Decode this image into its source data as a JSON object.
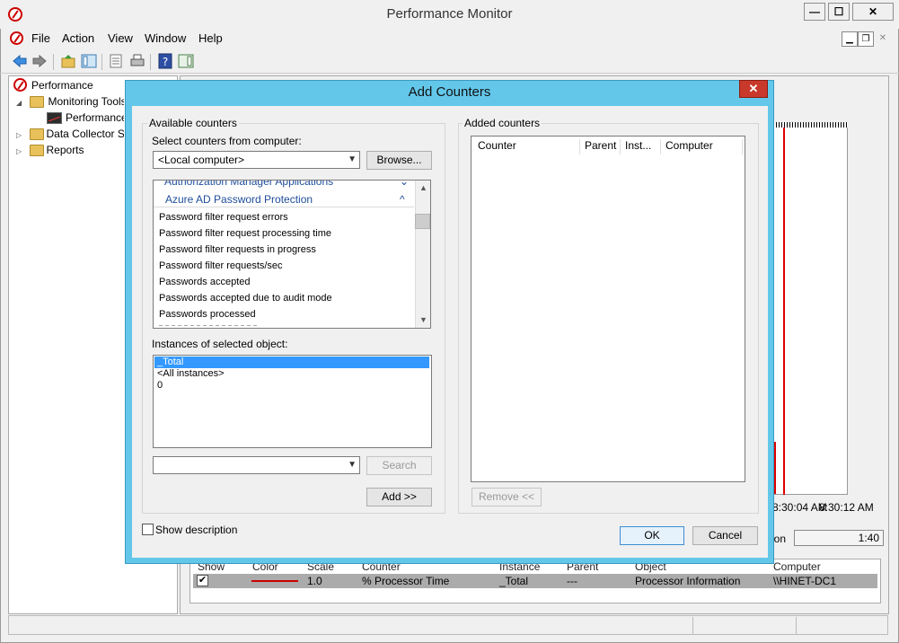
{
  "window": {
    "title": "Performance Monitor",
    "min": "—",
    "max": "☐",
    "close": "✕"
  },
  "menu": [
    "File",
    "Action",
    "View",
    "Window",
    "Help"
  ],
  "tree": {
    "items": [
      {
        "label": "Performance"
      },
      {
        "label": "Monitoring Tools"
      },
      {
        "label": "Performance Monitor"
      },
      {
        "label": "Data Collector Sets"
      },
      {
        "label": "Reports"
      }
    ]
  },
  "graph": {
    "time_1": "8:30:04 AM",
    "time_2": "8:30:12 AM",
    "duration_label": "ion",
    "duration_value": "1:40"
  },
  "counter_table": {
    "headers": [
      "Show",
      "Color",
      "Scale",
      "Counter",
      "Instance",
      "Parent",
      "Object",
      "Computer"
    ],
    "row": {
      "show": "✔",
      "scale": "1.0",
      "counter": "% Processor Time",
      "instance": "_Total",
      "parent": "---",
      "object": "Processor Information",
      "computer": "\\\\HINET-DC1"
    }
  },
  "dialog": {
    "title": "Add Counters",
    "close": "✕",
    "available_counters_label": "Available counters",
    "select_from_label": "Select counters from computer:",
    "computer_value": "<Local computer>",
    "browse_label": "Browse...",
    "categories": [
      {
        "label": "Authorization Manager Applications",
        "arrow": "⌄"
      },
      {
        "label": "Azure AD Password Protection",
        "arrow": "^"
      }
    ],
    "counters": [
      "Password filter request errors",
      "Password filter request processing time",
      "Password filter requests in progress",
      "Password filter requests/sec",
      "Passwords accepted",
      "Passwords accepted due to audit mode",
      "Passwords processed"
    ],
    "instances_label": "Instances of selected object:",
    "instances": [
      "_Total",
      "<All instances>",
      "0"
    ],
    "search_value": "",
    "search_label": "Search",
    "add_label": "Add >>",
    "added_counters_label": "Added counters",
    "added_headers": [
      "Counter",
      "Parent",
      "Inst...",
      "Computer"
    ],
    "remove_label": "Remove <<",
    "show_description_label": "Show description",
    "ok_label": "OK",
    "cancel_label": "Cancel"
  },
  "colors": {
    "dialog_frame": "#63c7ea",
    "close_red": "#c8392b",
    "selection": "#3399ff",
    "graph_line": "#d00000"
  }
}
